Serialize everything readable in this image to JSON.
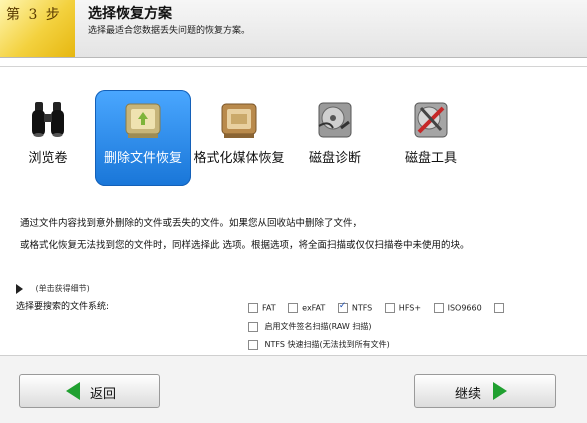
{
  "header": {
    "step": "第 3 步",
    "title": "选择恢复方案",
    "subtitle": "选择最适合您数据丢失问题的恢复方案。"
  },
  "modes": [
    {
      "label": "浏览卷",
      "icon": "binoculars-icon",
      "selected": false
    },
    {
      "label": "删除文件恢复",
      "icon": "recycle-drive-icon",
      "selected": true
    },
    {
      "label": "格式化媒体恢复",
      "icon": "format-drive-icon",
      "selected": false
    },
    {
      "label": "磁盘诊断",
      "icon": "disk-diagnostic-icon",
      "selected": false
    },
    {
      "label": "磁盘工具",
      "icon": "disk-tools-icon",
      "selected": false
    }
  ],
  "description": {
    "line1": "通过文件内容找到意外删除的文件或丢失的文件。如果您从回收站中删除了文件，",
    "line2": "或格式化恢复无法找到您的文件时，同样选择此 选项。根据选项，将全面扫描或仅仅扫描卷中未使用的块。"
  },
  "details_link": "(单击获得细节)",
  "fs_label": "选择要搜索的文件系统:",
  "filesystems": [
    {
      "label": "FAT",
      "checked": false
    },
    {
      "label": "exFAT",
      "checked": false
    },
    {
      "label": "NTFS",
      "checked": true
    },
    {
      "label": "HFS+",
      "checked": false
    },
    {
      "label": "ISO9660",
      "checked": false
    },
    {
      "label": "",
      "checked": false
    }
  ],
  "raw_scan_label": "启用文件签名扫描(RAW 扫描)",
  "ntfs_fast_label": "NTFS 快速扫描(无法找到所有文件)",
  "buttons": {
    "back": "返回",
    "next": "继续"
  },
  "colors": {
    "accent": "#1976d8",
    "step_yellow": "#f3d13e",
    "arrow_green": "#20a030"
  }
}
